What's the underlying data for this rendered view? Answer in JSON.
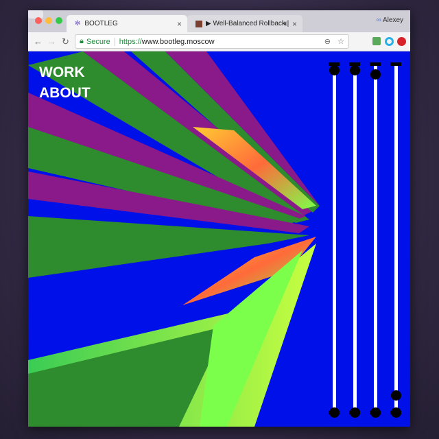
{
  "browser": {
    "tabs": [
      {
        "label": "BOOTLEG",
        "active": true
      },
      {
        "label": "▶ Well-Balanced Rollback |",
        "muted_icon": "speaker-icon"
      }
    ],
    "user": "Alexey",
    "secure_label": "Secure",
    "url_scheme": "https://",
    "url_host": "www.bootleg.moscow"
  },
  "site": {
    "menu": [
      {
        "label": "WORK"
      },
      {
        "label": "ABOUT"
      }
    ],
    "sliders": [
      {
        "top": 0.02,
        "bottom": 1.0
      },
      {
        "top": 0.02,
        "bottom": 1.0
      },
      {
        "top": 0.03,
        "bottom": 1.0
      },
      {
        "top": 0.0,
        "bottom": 0.98
      }
    ],
    "colors": {
      "background": "#0010e8",
      "green": "#2e8b2e",
      "purple": "#8a1a8a",
      "lime": "#7cff4a"
    }
  }
}
